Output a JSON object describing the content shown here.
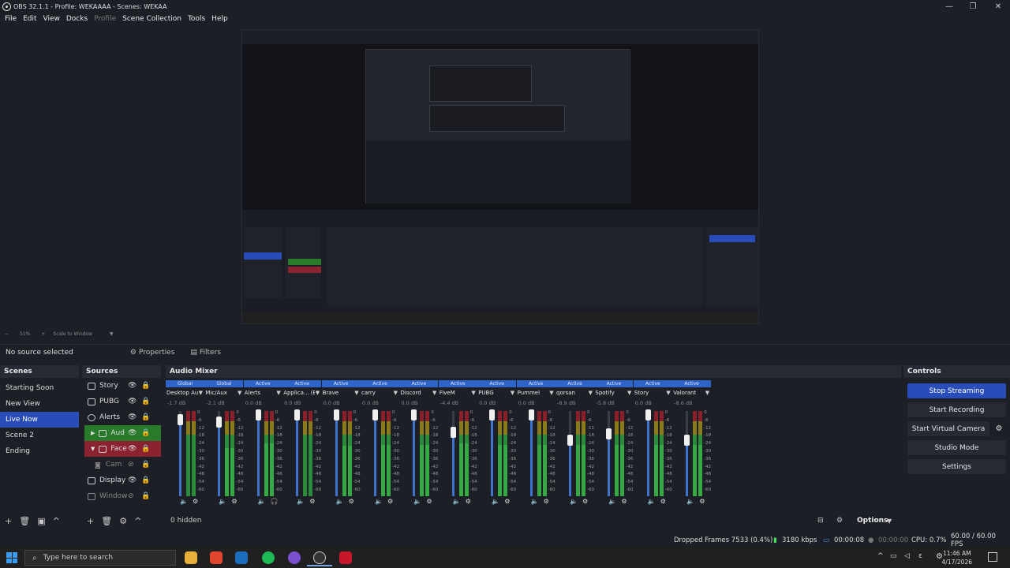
{
  "window": {
    "title": "OBS 32.1.1 - Profile: WEKAAAA - Scenes: WEKAA",
    "minimize": "—",
    "maximize": "❐",
    "close": "✕"
  },
  "menu": [
    "File",
    "Edit",
    "View",
    "Docks",
    "Profile",
    "Scene Collection",
    "Tools",
    "Help"
  ],
  "source_bar": {
    "no_source": "No source selected",
    "properties": "Properties",
    "filters": "Filters"
  },
  "scenes": {
    "title": "Scenes",
    "items": [
      "Starting Soon",
      "New View",
      "Live Now",
      "Scene 2",
      "Ending"
    ]
  },
  "sources": {
    "title": "Sources",
    "items": [
      "Story",
      "PUBG",
      "Alerts",
      "Aud",
      "Face",
      "Cam",
      "Display",
      "Window"
    ],
    "hidden": "0 hidden"
  },
  "mixer": {
    "title": "Audio Mixer",
    "scale": [
      "0",
      "-6",
      "-12",
      "-18",
      "-24",
      "-30",
      "-36",
      "-42",
      "-48",
      "-54",
      "-60"
    ],
    "channels": [
      {
        "status": "Global",
        "name": "Desktop Audio",
        "db": "-1.7 dB"
      },
      {
        "status": "Global",
        "name": "Mic/Aux",
        "db": "-2.1 dB"
      },
      {
        "status": "Active",
        "name": "Alerts",
        "db": "0.0 dB"
      },
      {
        "status": "Active",
        "name": "Applica... (BETA)",
        "db": "0.0 dB"
      },
      {
        "status": "Active",
        "name": "Brave",
        "db": "0.0 dB"
      },
      {
        "status": "Active",
        "name": "carry",
        "db": "0.0 dB"
      },
      {
        "status": "Active",
        "name": "Discord",
        "db": "0.0 dB"
      },
      {
        "status": "Active",
        "name": "FiveM",
        "db": "-4.4 dB"
      },
      {
        "status": "Active",
        "name": "PUBG",
        "db": "0.0 dB"
      },
      {
        "status": "Active",
        "name": "Pummel",
        "db": "0.0 dB"
      },
      {
        "status": "Active",
        "name": "qorsan",
        "db": "-8.9 dB"
      },
      {
        "status": "Active",
        "name": "Spotify",
        "db": "-5.8 dB"
      },
      {
        "status": "Active",
        "name": "Story",
        "db": "0.0 dB"
      },
      {
        "status": "Active",
        "name": "Valorant",
        "db": "-8.6 dB"
      }
    ],
    "options": "Options"
  },
  "controls": {
    "title": "Controls",
    "stop_streaming": "Stop Streaming",
    "start_recording": "Start Recording",
    "start_virtual_camera": "Start Virtual Camera",
    "studio_mode": "Studio Mode",
    "settings": "Settings"
  },
  "status": {
    "dropped_frames": "Dropped Frames 7533 (0.4%)",
    "bitrate": "3180 kbps",
    "stream_time": "00:00:08",
    "rec_time": "00:00:00",
    "cpu": "CPU: 0.7%",
    "fps": "60.00 / 60.00 FPS"
  },
  "taskbar": {
    "search_placeholder": "Type here to search",
    "time": "11:46 AM",
    "date": "4/17/2026"
  },
  "preview": {
    "zoom": "51%",
    "scale_mode": "Scale to Window"
  },
  "colors": {
    "accent": "#284cb8",
    "bg": "#1d1f26",
    "meter_green": "#2a8c3a",
    "meter_red": "#8a1f2a"
  }
}
